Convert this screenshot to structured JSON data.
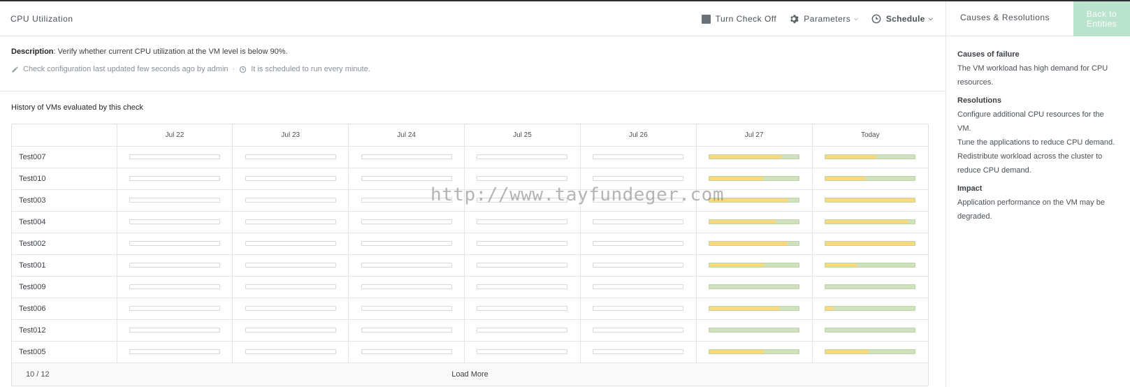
{
  "header": {
    "title": "CPU Utilization",
    "turn_check_off": "Turn Check Off",
    "parameters": "Parameters",
    "schedule": "Schedule"
  },
  "description": {
    "label": "Description",
    "text": ": Verify whether current CPU utilization at the VM level is below 90%.",
    "meta_updated": "Check configuration last updated few seconds ago by admin",
    "meta_dot": "·",
    "meta_schedule": "It is scheduled to run every minute."
  },
  "history": {
    "title": "History of VMs evaluated by this check",
    "columns": [
      "Jul 22",
      "Jul 23",
      "Jul 24",
      "Jul 25",
      "Jul 26",
      "Jul 27",
      "Today"
    ],
    "rows": [
      {
        "name": "Test007",
        "jul27": 0.8,
        "today": 0.57
      },
      {
        "name": "Test010",
        "jul27": 0.6,
        "today": 0.44
      },
      {
        "name": "Test003",
        "jul27": 0.87,
        "today": 1.0
      },
      {
        "name": "Test004",
        "jul27": 0.74,
        "today": 0.93
      },
      {
        "name": "Test002",
        "jul27": 0.87,
        "today": 1.0
      },
      {
        "name": "Test001",
        "jul27": 0.61,
        "today": 0.35
      },
      {
        "name": "Test009",
        "jul27": 0.0,
        "today": 0.0
      },
      {
        "name": "Test006",
        "jul27": 0.78,
        "today": 0.09
      },
      {
        "name": "Test012",
        "jul27": 0.0,
        "today": 0.0
      },
      {
        "name": "Test005",
        "jul27": 0.61,
        "today": 0.48
      }
    ],
    "count": "10 / 12",
    "load_more": "Load More"
  },
  "watermark": "http://www.tayfundeger.com",
  "panel": {
    "title": "Causes & Resolutions",
    "back_line1": "Back to",
    "back_line2": "Entities",
    "causes_heading": "Causes of failure",
    "causes_text": "The VM workload has high demand for CPU resources.",
    "resolutions_heading": "Resolutions",
    "resolutions": [
      "Configure additional CPU resources for the VM.",
      "Tune the applications to reduce CPU demand.",
      "Redistribute workload across the cluster to reduce CPU demand."
    ],
    "impact_heading": "Impact",
    "impact_text": "Application performance on the VM may be degraded."
  },
  "colors": {
    "warning_fill": "#fcd97d",
    "ok_fill": "#cfe2bc",
    "back_button": "#b9e3cc"
  }
}
